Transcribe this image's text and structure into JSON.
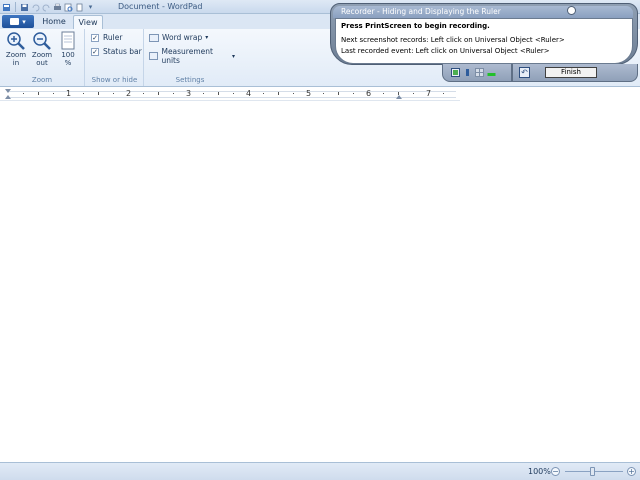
{
  "window": {
    "title": "Document - WordPad"
  },
  "tabs": [
    {
      "label": "Home"
    },
    {
      "label": "View"
    }
  ],
  "ribbon": {
    "zoom_group": {
      "label": "Zoom",
      "zoom_in": "Zoom\nin",
      "zoom_out": "Zoom\nout",
      "hundred": "100\n%"
    },
    "show_group": {
      "label": "Show or hide",
      "ruler": "Ruler",
      "status_bar": "Status bar",
      "ruler_checked": "✓",
      "status_checked": "✓"
    },
    "settings_group": {
      "label": "Settings",
      "word_wrap": "Word wrap",
      "measurement_units": "Measurement units"
    }
  },
  "ruler": {
    "numbers": [
      "1",
      "2",
      "3",
      "4",
      "5",
      "6",
      "7"
    ]
  },
  "statusbar": {
    "zoom_percent": "100%",
    "zoom_minus": "−",
    "zoom_plus": "+"
  },
  "recorder": {
    "title": "Recorder - Hiding and Displaying the Ruler",
    "instruction": "Press PrintScreen to begin recording.",
    "next_screenshot": "Next screenshot records: Left click on Universal Object <Ruler>",
    "last_event": "Last recorded event:        Left click on Universal Object <Ruler>",
    "finish_label": "Finish"
  },
  "colors": {
    "accent": "#1d4f99",
    "ribbon_text": "#1e395b",
    "recorder_frame": "#6e7f95"
  }
}
